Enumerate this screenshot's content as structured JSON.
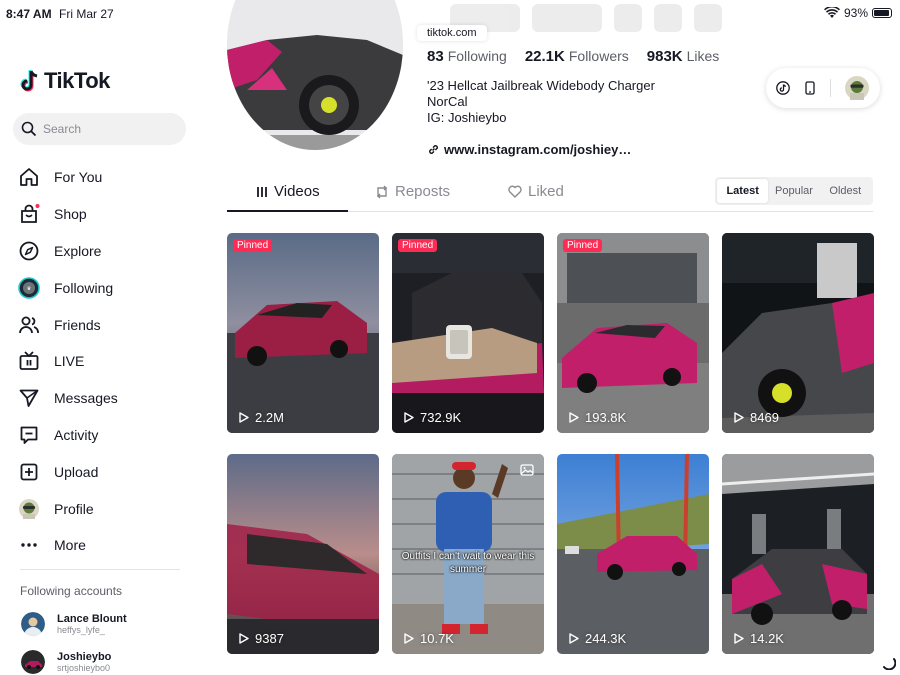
{
  "status_bar": {
    "time": "8:47 AM",
    "date": "Fri Mar 27",
    "battery": "93%"
  },
  "sidebar": {
    "logo": "TikTok",
    "search_placeholder": "Search",
    "nav": [
      {
        "label": "For You",
        "icon": "home-icon"
      },
      {
        "label": "Shop",
        "icon": "shop-icon"
      },
      {
        "label": "Explore",
        "icon": "compass-icon"
      },
      {
        "label": "Following",
        "icon": "following-avatar-icon"
      },
      {
        "label": "Friends",
        "icon": "friends-icon"
      },
      {
        "label": "LIVE",
        "icon": "live-icon"
      },
      {
        "label": "Messages",
        "icon": "messages-icon"
      },
      {
        "label": "Activity",
        "icon": "activity-icon"
      },
      {
        "label": "Upload",
        "icon": "upload-icon"
      },
      {
        "label": "Profile",
        "icon": "profile-avatar-icon"
      },
      {
        "label": "More",
        "icon": "more-icon"
      }
    ],
    "following_title": "Following accounts",
    "following_accounts": [
      {
        "name": "Lance Blount",
        "handle": "heffys_lyfe_"
      },
      {
        "name": "Joshieybo",
        "handle": "srtjoshieybo0"
      }
    ]
  },
  "profile": {
    "url_pill": "tiktok.com",
    "following_count": "83",
    "following_label": "Following",
    "followers_count": "22.1K",
    "followers_label": "Followers",
    "likes_count": "983K",
    "likes_label": "Likes",
    "bio_line1": "'23 Hellcat Jailbreak Widebody Charger",
    "bio_line2": "NorCal",
    "bio_line3": "IG: Joshieybo",
    "link": "www.instagram.com/joshiey…"
  },
  "tabs": [
    {
      "label": "Videos",
      "icon": "grid-lines-icon",
      "active": true
    },
    {
      "label": "Reposts",
      "icon": "repost-icon",
      "active": false
    },
    {
      "label": "Liked",
      "icon": "heart-icon",
      "active": false
    }
  ],
  "sort_options": [
    "Latest",
    "Popular",
    "Oldest"
  ],
  "sort_selected": "Latest",
  "videos": [
    {
      "views": "2.2M",
      "pinned": "Pinned"
    },
    {
      "views": "732.9K",
      "pinned": "Pinned"
    },
    {
      "views": "193.8K",
      "pinned": "Pinned"
    },
    {
      "views": "8469"
    },
    {
      "views": "9387"
    },
    {
      "views": "10.7K",
      "caption": "Outfits I can't wait to wear this summer"
    },
    {
      "views": "244.3K"
    },
    {
      "views": "14.2K"
    }
  ],
  "colors": {
    "accent": "#fe2c55",
    "car_magenta": "#c21f6a",
    "text": "#161823"
  }
}
